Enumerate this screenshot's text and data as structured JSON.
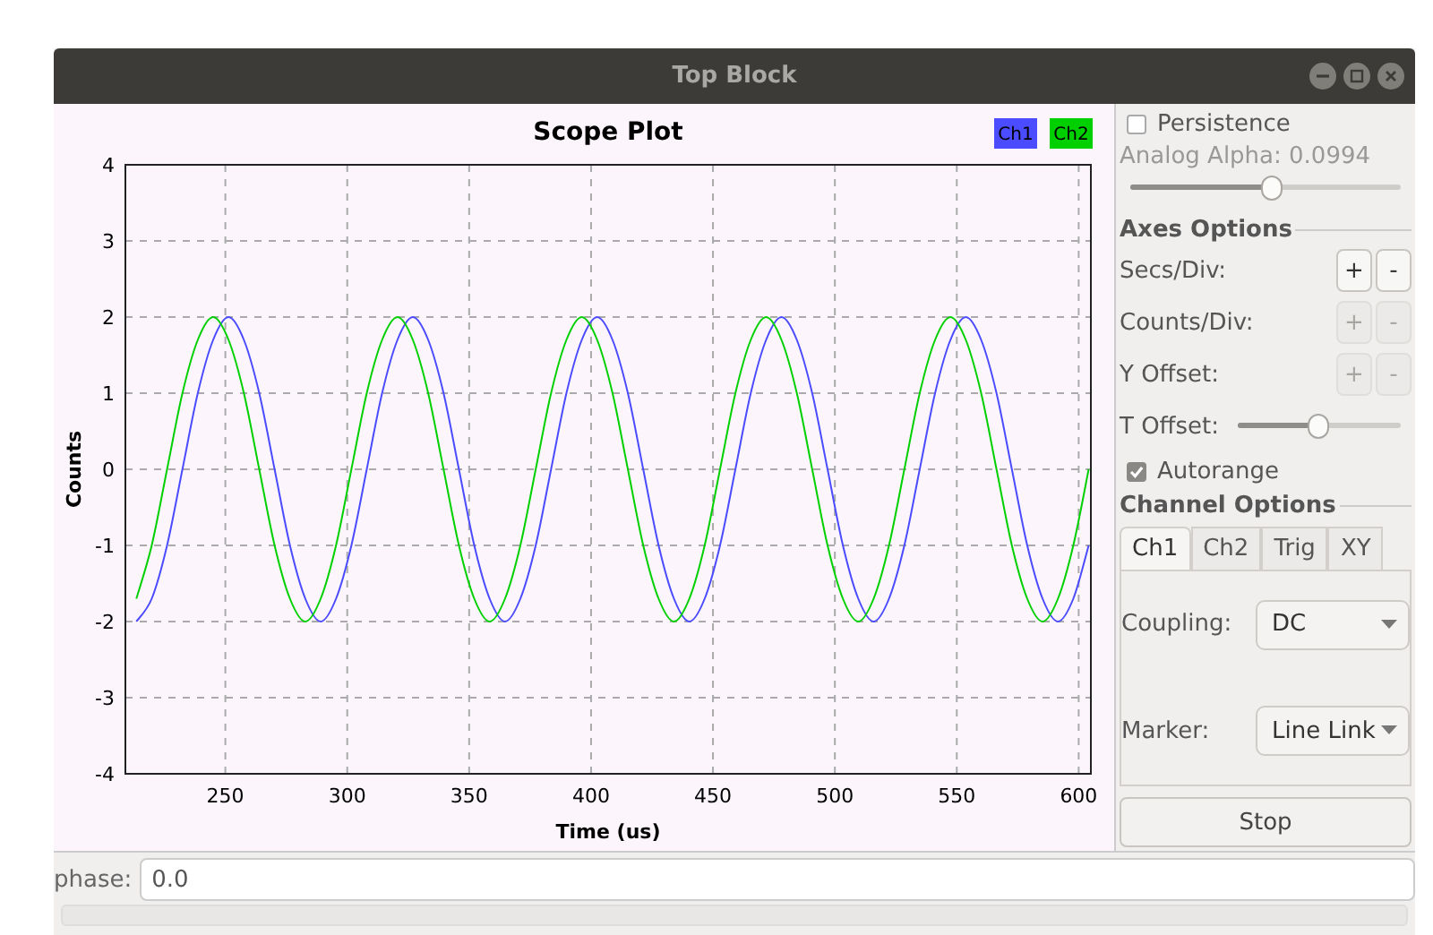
{
  "window": {
    "title": "Top Block"
  },
  "plot": {
    "chart_data": {
      "type": "line",
      "title": "Scope Plot",
      "xlabel": "Time (us)",
      "ylabel": "Counts",
      "grid": true,
      "xlim": [
        209,
        605
      ],
      "ylim": [
        -4,
        4
      ],
      "xticks": [
        250,
        300,
        350,
        400,
        450,
        500,
        550,
        600
      ],
      "yticks": [
        -4,
        -3,
        -2,
        -1,
        0,
        1,
        2,
        3,
        4
      ],
      "x": [
        213.5,
        219.8,
        226.1,
        232.4,
        238.7,
        245,
        251.3,
        257.6,
        263.9,
        270.2,
        276.5,
        282.8,
        289.1,
        295.4,
        301.7,
        308,
        314.3,
        320.6,
        326.9,
        333.2,
        339.5,
        345.8,
        352.1,
        358.4,
        364.7,
        371,
        377.3,
        383.6,
        389.9,
        396.2,
        402.5,
        408.8,
        415.1,
        421.4,
        427.7,
        434,
        440.3,
        446.6,
        452.9,
        459.2,
        465.5,
        471.8,
        478.1,
        484.4,
        490.7,
        497,
        503.3,
        509.6,
        515.9,
        522.2,
        528.5,
        534.8,
        541.1,
        547.4,
        553.7,
        560,
        566.3,
        572.6,
        578.9,
        585.2,
        591.5,
        597.8,
        604.1
      ],
      "series": [
        {
          "name": "Ch1",
          "color": "#4b4bff",
          "values": [
            -2,
            -1.7,
            -1,
            0,
            1,
            1.7,
            2,
            1.7,
            1,
            0,
            -1,
            -1.7,
            -2,
            -1.7,
            -1,
            0,
            1,
            1.7,
            2,
            1.7,
            1,
            0,
            -1,
            -1.7,
            -2,
            -1.7,
            -1,
            0,
            1,
            1.7,
            2,
            1.7,
            1,
            0,
            -1,
            -1.7,
            -2,
            -1.7,
            -1,
            0,
            1,
            1.7,
            2,
            1.7,
            1,
            0,
            -1,
            -1.7,
            -2,
            -1.7,
            -1,
            0,
            1,
            1.7,
            2,
            1.7,
            1,
            0,
            -1,
            -1.7,
            -2,
            -1.7,
            -1
          ]
        },
        {
          "name": "Ch2",
          "color": "#00d000",
          "values": [
            -1.7,
            -1,
            0,
            1,
            1.7,
            2,
            1.7,
            1,
            0,
            -1,
            -1.7,
            -2,
            -1.7,
            -1,
            0,
            1,
            1.7,
            2,
            1.7,
            1,
            0,
            -1,
            -1.7,
            -2,
            -1.7,
            -1,
            0,
            1,
            1.7,
            2,
            1.7,
            1,
            0,
            -1,
            -1.7,
            -2,
            -1.7,
            -1,
            0,
            1,
            1.7,
            2,
            1.7,
            1,
            0,
            -1,
            -1.7,
            -2,
            -1.7,
            -1,
            0,
            1,
            1.7,
            2,
            1.7,
            1,
            0,
            -1,
            -1.7,
            -2,
            -1.7,
            -1,
            0
          ]
        }
      ]
    }
  },
  "controls": {
    "persistence": {
      "label": "Persistence",
      "checked": false
    },
    "analog_alpha": {
      "label": "Analog Alpha: 0.0994",
      "level": 0.52
    },
    "axes_options": {
      "title": "Axes Options",
      "rows": [
        {
          "kind": "buttons",
          "label": "Secs/Div:",
          "buttons": [
            {
              "label": "+",
              "disabled": false
            },
            {
              "label": "-",
              "disabled": false
            }
          ]
        },
        {
          "kind": "buttons",
          "label": "Counts/Div:",
          "buttons": [
            {
              "label": "+",
              "disabled": true
            },
            {
              "label": "-",
              "disabled": true
            }
          ]
        },
        {
          "kind": "buttons",
          "label": "Y Offset:",
          "buttons": [
            {
              "label": "+",
              "disabled": true
            },
            {
              "label": "-",
              "disabled": true
            }
          ]
        },
        {
          "kind": "slider",
          "label": "T Offset:",
          "level": 0.5
        }
      ]
    },
    "autorange": {
      "label": "Autorange",
      "checked": true
    },
    "channel_options": {
      "title": "Channel Options",
      "tabs": [
        {
          "label": "Ch1",
          "selected": true
        },
        {
          "label": "Ch2",
          "selected": false
        },
        {
          "label": "Trig",
          "selected": false
        },
        {
          "label": "XY",
          "selected": false
        }
      ],
      "fields": [
        {
          "label": "Coupling:",
          "value": "DC"
        },
        {
          "label": "Marker:",
          "value": "Line Link"
        }
      ]
    },
    "stop_button": "Stop"
  },
  "parameter": {
    "label": "phase:",
    "value": "0.0"
  }
}
